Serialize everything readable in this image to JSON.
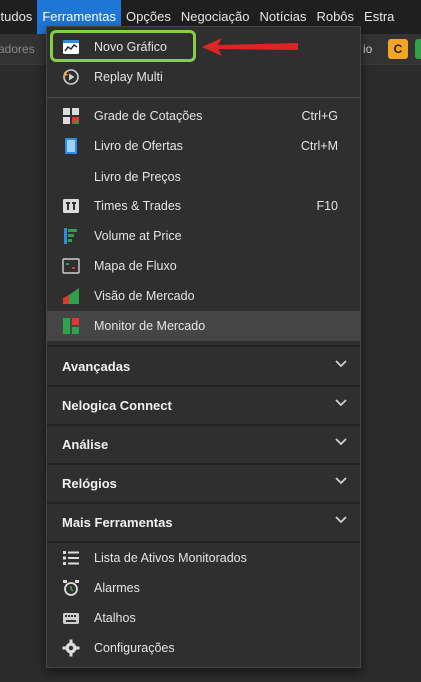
{
  "menubar": {
    "items": [
      "studos",
      "Ferramentas",
      "Opções",
      "Negociação",
      "Notícias",
      "Robôs",
      "Estra"
    ]
  },
  "toolbar": {
    "left_text": "adores",
    "right_text": "io",
    "orange_badge": "C",
    "green_badge": ""
  },
  "menu": {
    "group1": [
      {
        "label": "Novo Gráfico",
        "icon": "chart-window-icon"
      },
      {
        "label": "Replay Multi",
        "icon": "replay-icon"
      }
    ],
    "group2": [
      {
        "label": "Grade de Cotações",
        "shortcut": "Ctrl+G",
        "icon": "grid-icon"
      },
      {
        "label": "Livro de Ofertas",
        "shortcut": "Ctrl+M",
        "icon": "book-icon"
      },
      {
        "label": "Livro de Preços",
        "shortcut": "",
        "icon": ""
      },
      {
        "label": "Times & Trades",
        "shortcut": "F10",
        "icon": "times-trades-icon"
      },
      {
        "label": "Volume at Price",
        "shortcut": "",
        "icon": "volume-icon"
      },
      {
        "label": "Mapa de Fluxo",
        "shortcut": "",
        "icon": "flow-map-icon"
      },
      {
        "label": "Visão de Mercado",
        "shortcut": "",
        "icon": "market-view-icon"
      },
      {
        "label": "Monitor de Mercado",
        "shortcut": "",
        "icon": "market-monitor-icon"
      }
    ],
    "sections": [
      "Avançadas",
      "Nelogica Connect",
      "Análise",
      "Relógios",
      "Mais Ferramentas"
    ],
    "group3": [
      {
        "label": "Lista de Ativos Monitorados",
        "icon": "list-icon"
      },
      {
        "label": "Alarmes",
        "icon": "alarm-icon"
      },
      {
        "label": "Atalhos",
        "icon": "keyboard-icon"
      },
      {
        "label": "Configurações",
        "icon": "gear-icon"
      }
    ]
  },
  "colors": {
    "accent": "#1e76d6",
    "callout": "#86cf45",
    "arrow": "#e02424"
  }
}
